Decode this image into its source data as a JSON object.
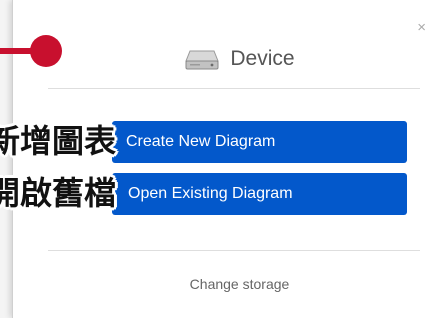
{
  "dialog": {
    "close_label": "×",
    "storage_name": "Device",
    "storage_icon": "hard-drive-icon",
    "create_button_label": "Create New Diagram",
    "open_button_label": "Open Existing Diagram",
    "change_storage_label": "Change storage"
  },
  "annotations": {
    "create_label": "新增圖表",
    "open_label": "開啟舊檔",
    "marker_color": "#c8102e"
  },
  "colors": {
    "button_blue": "#0358cb"
  }
}
